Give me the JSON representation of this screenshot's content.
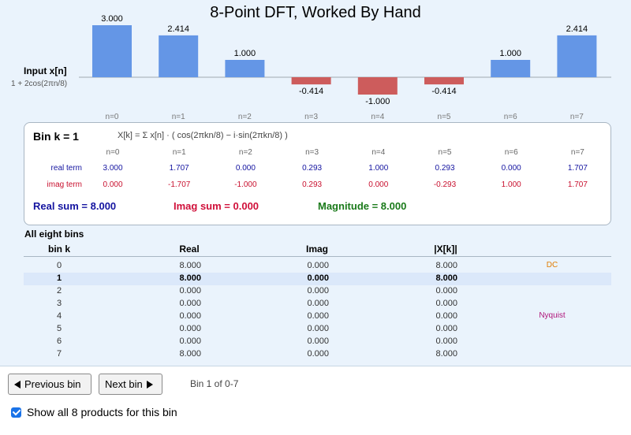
{
  "title": "8-Point DFT, Worked By Hand",
  "signal": {
    "label": "Input x[n]",
    "formula": "1 + 2cos(2πn/8)"
  },
  "colors": {
    "positive": "#6496e6",
    "negative": "#cd5c5c",
    "real": "#1414a0",
    "imag": "#d0103a",
    "magnitude": "#1a7a1a",
    "dc": "#e07b00",
    "nyquist": "#b0157a"
  },
  "chart_data": {
    "type": "bar",
    "categories": [
      "n=0",
      "n=1",
      "n=2",
      "n=3",
      "n=4",
      "n=5",
      "n=6",
      "n=7"
    ],
    "values": [
      3.0,
      2.414,
      1.0,
      -0.414,
      -1.0,
      -0.414,
      1.0,
      2.414
    ],
    "value_labels": [
      "3.000",
      "2.414",
      "1.000",
      "-0.414",
      "-1.000",
      "-0.414",
      "1.000",
      "2.414"
    ],
    "title": "8-Point DFT, Worked By Hand",
    "ylabel": "Input x[n]",
    "ylim": [
      -1,
      3
    ],
    "grid": false
  },
  "bin_detail": {
    "title": "Bin k = 1",
    "formula": "X[k] = Σ x[n] · ( cos(2πkn/8) − i·sin(2πkn/8) )",
    "columns": [
      "n=0",
      "n=1",
      "n=2",
      "n=3",
      "n=4",
      "n=5",
      "n=6",
      "n=7"
    ],
    "real_label": "real term",
    "real_terms": [
      "3.000",
      "1.707",
      "0.000",
      "0.293",
      "1.000",
      "0.293",
      "0.000",
      "1.707"
    ],
    "imag_label": "imag term",
    "imag_terms": [
      "0.000",
      "-1.707",
      "-1.000",
      "0.293",
      "0.000",
      "-0.293",
      "1.000",
      "1.707"
    ],
    "real_sum": "Real sum = 8.000",
    "imag_sum": "Imag sum = 0.000",
    "magnitude": "Magnitude = 8.000"
  },
  "all_bins": {
    "title": "All eight bins",
    "headers": {
      "k": "bin k",
      "real": "Real",
      "imag": "Imag",
      "mag": "|X[k]|"
    },
    "rows": [
      {
        "k": "0",
        "real": "8.000",
        "imag": "0.000",
        "mag": "8.000",
        "note": "DC"
      },
      {
        "k": "1",
        "real": "8.000",
        "imag": "0.000",
        "mag": "8.000",
        "note": ""
      },
      {
        "k": "2",
        "real": "0.000",
        "imag": "0.000",
        "mag": "0.000",
        "note": ""
      },
      {
        "k": "3",
        "real": "0.000",
        "imag": "0.000",
        "mag": "0.000",
        "note": ""
      },
      {
        "k": "4",
        "real": "0.000",
        "imag": "0.000",
        "mag": "0.000",
        "note": "Nyquist"
      },
      {
        "k": "5",
        "real": "0.000",
        "imag": "0.000",
        "mag": "0.000",
        "note": ""
      },
      {
        "k": "6",
        "real": "0.000",
        "imag": "0.000",
        "mag": "0.000",
        "note": ""
      },
      {
        "k": "7",
        "real": "8.000",
        "imag": "0.000",
        "mag": "8.000",
        "note": ""
      }
    ],
    "selected_k": "1"
  },
  "controls": {
    "prev_label": "Previous bin",
    "next_label": "Next bin",
    "status": "Bin 1 of 0-7",
    "show_all_label": "Show all 8 products for this bin",
    "show_all_checked": true
  }
}
